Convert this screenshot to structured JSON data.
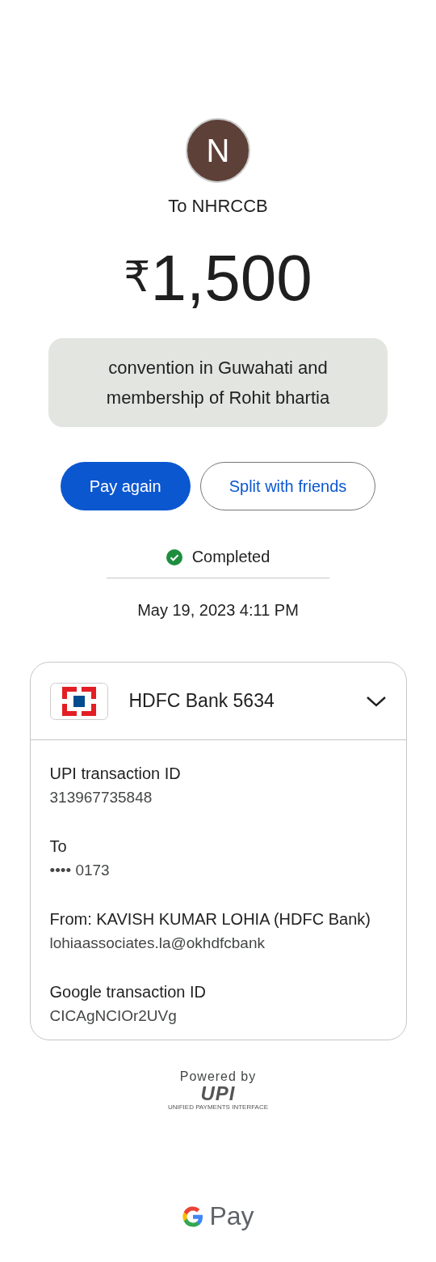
{
  "payee": {
    "initial": "N",
    "to_label": "To NHRCCB"
  },
  "amount": {
    "currency": "₹",
    "value": "1,500"
  },
  "note": "convention in Guwahati and membership of Rohit bhartia",
  "actions": [
    {
      "label": "Pay again",
      "kind": "primary"
    },
    {
      "label": "Split with friends",
      "kind": "outline"
    }
  ],
  "status": {
    "label": "Completed",
    "kind": "success"
  },
  "date": "May 19, 2023 4:11 PM",
  "account": {
    "bank": "HDFC Bank 5634",
    "expanded": true,
    "details": [
      {
        "label": "UPI transaction ID",
        "value": "313967735848"
      },
      {
        "label": "To",
        "value": "•••• 0173"
      },
      {
        "label": "From: KAVISH KUMAR LOHIA (HDFC Bank)",
        "value": "lohiaassociates.la@okhdfcbank"
      },
      {
        "label": "Google transaction ID",
        "value": "CICAgNCIOr2UVg"
      }
    ]
  },
  "footer": {
    "powered_by": "Powered by",
    "upi_logo": "UPI",
    "upi_tagline": "UNIFIED PAYMENTS INTERFACE",
    "brand": "Pay"
  }
}
